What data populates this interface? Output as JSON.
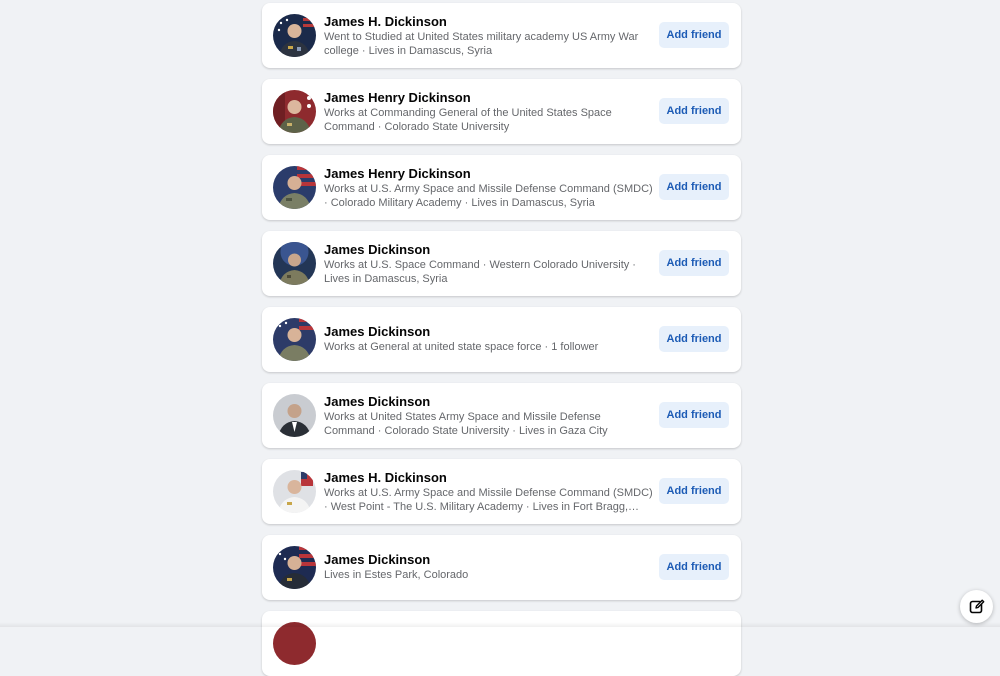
{
  "results": [
    {
      "name": "James H. Dickinson",
      "description": "Went to Studied at United States military academy US Army War college · Lives in Damascus, Syria",
      "button_label": "Add friend",
      "avatar_background": "#1b2a4a"
    },
    {
      "name": "James Henry Dickinson",
      "description": "Works at Commanding General of the United States Space Command · Colorado State University",
      "button_label": "Add friend",
      "avatar_background": "#8e2a2e"
    },
    {
      "name": "James Henry Dickinson",
      "description": "Works at U.S. Army Space and Missile Defense Command (SMDC) · Colorado Military Academy · Lives in Damascus, Syria",
      "button_label": "Add friend",
      "avatar_background": "#2b3c6b"
    },
    {
      "name": "James Dickinson",
      "description": "Works at U.S. Space Command · Western Colorado University · Lives in Damascus, Syria",
      "button_label": "Add friend",
      "avatar_background": "#233656"
    },
    {
      "name": "James Dickinson",
      "description": "Works at General at united state space force · 1 follower",
      "button_label": "Add friend",
      "avatar_background": "#2d3b68"
    },
    {
      "name": "James Dickinson",
      "description": "Works at United States Army Space and Missile Defense Command · Colorado State University · Lives in Gaza City",
      "button_label": "Add friend",
      "avatar_background": "#c9ccd1"
    },
    {
      "name": "James H. Dickinson",
      "description": "Works at U.S. Army Space and Missile Defense Command (SMDC) · West Point - The U.S. Military Academy · Lives in Fort Bragg, North Carolina",
      "button_label": "Add friend",
      "avatar_background": "#dfe1e5"
    },
    {
      "name": "James Dickinson",
      "description": "Lives in Estes Park, Colorado",
      "button_label": "Add friend",
      "avatar_background": "#1e2b52"
    }
  ],
  "colors": {
    "page_background": "#f0f2f5",
    "card_background": "#ffffff",
    "button_background": "#e7f0fb",
    "button_text": "#1c5bb5",
    "name_text": "#050505",
    "secondary_text": "#65676b"
  },
  "icons": {
    "compose_button": "new-message-icon"
  }
}
